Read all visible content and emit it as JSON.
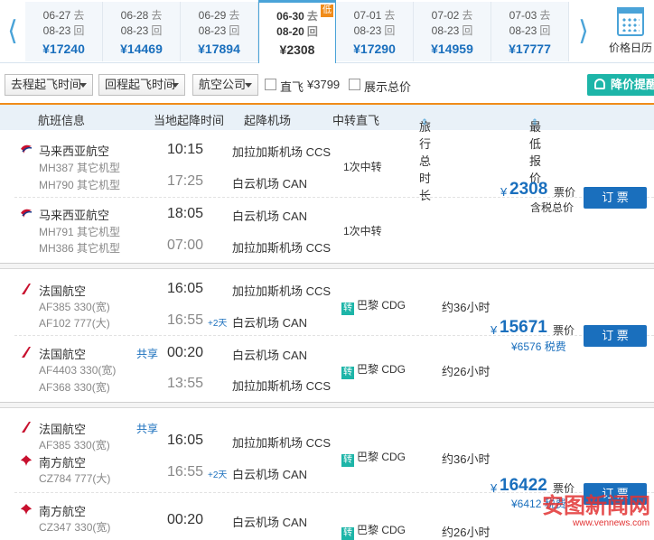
{
  "dates": [
    {
      "go": "06-27",
      "go_tag": "去",
      "back": "08-23",
      "back_tag": "回",
      "price": "¥17240"
    },
    {
      "go": "06-28",
      "go_tag": "去",
      "back": "08-23",
      "back_tag": "回",
      "price": "¥14469"
    },
    {
      "go": "06-29",
      "go_tag": "去",
      "back": "08-23",
      "back_tag": "回",
      "price": "¥17894"
    },
    {
      "go": "06-30",
      "go_tag": "去",
      "back": "08-20",
      "back_tag": "回",
      "price": "¥2308",
      "badge": "低",
      "active": true
    },
    {
      "go": "07-01",
      "go_tag": "去",
      "back": "08-23",
      "back_tag": "回",
      "price": "¥17290"
    },
    {
      "go": "07-02",
      "go_tag": "去",
      "back": "08-23",
      "back_tag": "回",
      "price": "¥14959"
    },
    {
      "go": "07-03",
      "go_tag": "去",
      "back": "08-23",
      "back_tag": "回",
      "price": "¥17777"
    }
  ],
  "nav": {
    "prev": "⟨",
    "next": "⟩",
    "calendar": "价格日历"
  },
  "filters": {
    "outbound_time": "去程起飞时间",
    "return_time": "回程起飞时间",
    "airline": "航空公司",
    "direct_label": "直飞",
    "direct_price": "¥3799",
    "show_total": "展示总价",
    "alert": "降价提醒"
  },
  "columns": {
    "flight": "航班信息",
    "time": "当地起降时间",
    "airport": "起降机场",
    "transfer": "中转直飞",
    "duration": "旅行总时长",
    "price": "最低报价",
    "sort_mark": "⇕"
  },
  "groups": [
    {
      "legs": [
        {
          "airline": "马来西亚航空",
          "flight1": "MH387 其它机型",
          "flight2": "MH790 其它机型",
          "dep": "10:15",
          "arr": "17:25",
          "ap1": "加拉加斯机场 CCS",
          "ap2": "白云机场 CAN",
          "transfer": "1次中转"
        },
        {
          "airline": "马来西亚航空",
          "flight1": "MH791 其它机型",
          "flight2": "MH386 其它机型",
          "dep": "18:05",
          "arr": "07:00",
          "ap1": "白云机场 CAN",
          "ap2": "加拉加斯机场 CCS",
          "transfer": "1次中转"
        }
      ],
      "price": "2308",
      "price_label": "票价",
      "note": "含税总价"
    },
    {
      "legs": [
        {
          "airline": "法国航空",
          "flight1": "AF385 330(宽)",
          "flight2": "AF102 777(大)",
          "dep": "16:05",
          "arr": "16:55",
          "plus": "+2天",
          "ap1": "加拉加斯机场 CCS",
          "ap2": "白云机场 CAN",
          "zhuan": "转",
          "transfer": "巴黎 CDG",
          "duration": "约36小时"
        },
        {
          "airline": "法国航空",
          "share": "共享",
          "flight1": "AF4403 330(宽)",
          "flight2": "AF368 330(宽)",
          "dep": "00:20",
          "arr": "13:55",
          "ap1": "白云机场 CAN",
          "ap2": "加拉加斯机场 CCS",
          "zhuan": "转",
          "transfer": "巴黎 CDG",
          "duration": "约26小时"
        }
      ],
      "price": "15671",
      "price_label": "票价",
      "tax": "¥6576 税费"
    },
    {
      "legs": [
        {
          "airline": "法国航空",
          "share": "共享",
          "flight1": "AF385 330(宽)",
          "airline_b": "南方航空",
          "flight2": "CZ784 777(大)",
          "dep": "16:05",
          "arr": "16:55",
          "plus": "+2天",
          "ap1": "加拉加斯机场 CCS",
          "ap2": "白云机场 CAN",
          "zhuan": "转",
          "transfer": "巴黎 CDG",
          "duration": "约36小时"
        },
        {
          "airline": "南方航空",
          "flight1": "CZ347 330(宽)",
          "dep": "00:20",
          "ap1": "白云机场 CAN",
          "zhuan": "转",
          "transfer": "巴黎 CDG",
          "duration": "约26小时"
        }
      ],
      "price": "16422",
      "price_label": "票价",
      "tax": "¥6412 税费"
    }
  ],
  "book_label": "订 票",
  "yen": "¥",
  "watermark": "安图新闻网",
  "watermark_url": "www.vennews.com",
  "colors": {
    "accent": "#1a6fbd",
    "teal": "#1db5a8",
    "orange": "#f08c1a"
  }
}
